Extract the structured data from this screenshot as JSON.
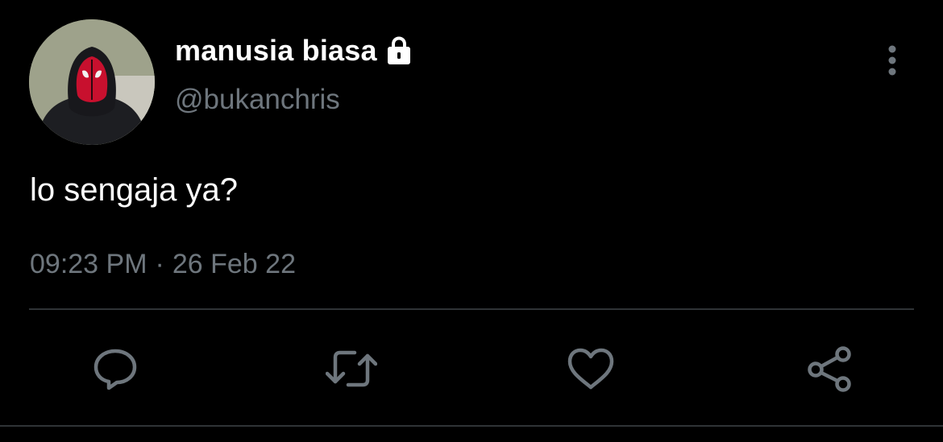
{
  "user": {
    "display_name": "manusia biasa",
    "handle": "@bukanchris",
    "protected_icon": "lock-icon",
    "avatar_icon": "masked-person-avatar"
  },
  "tweet": {
    "text": "lo sengaja ya?",
    "time": "09:23 PM",
    "separator": "·",
    "date": "26 Feb 22"
  },
  "actions": {
    "more": "more-options-icon",
    "reply": "reply-icon",
    "retweet": "retweet-icon",
    "like": "like-icon",
    "share": "share-icon"
  },
  "colors": {
    "background": "#000000",
    "primary_text": "#ffffff",
    "secondary_text": "#6e767d",
    "divider": "#2f3336"
  }
}
